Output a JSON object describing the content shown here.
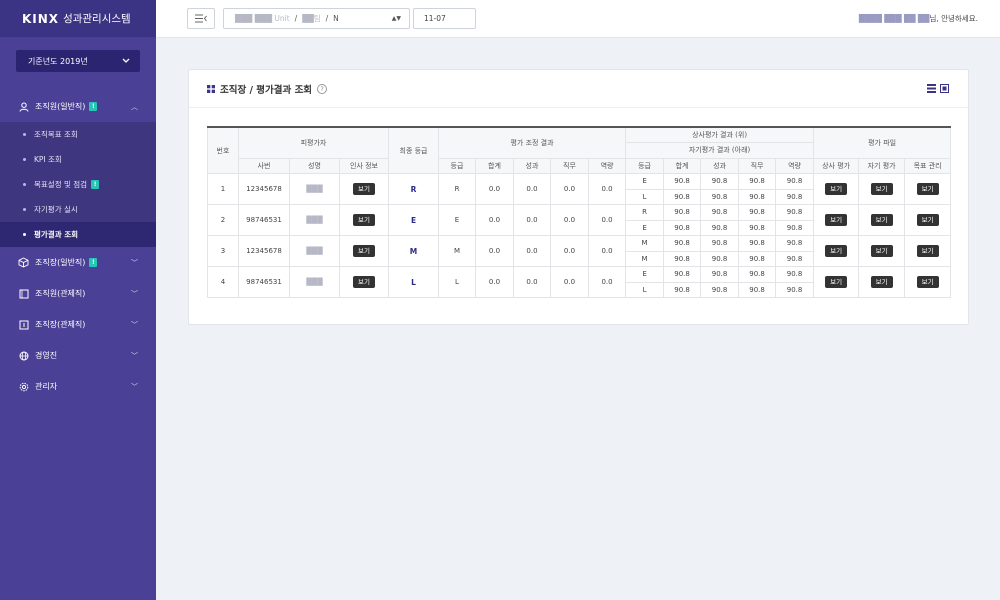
{
  "app": {
    "brand": "KINX",
    "system_name": "성과관리시스템"
  },
  "year_select": {
    "value": "기준년도 2019년"
  },
  "sidebar": {
    "items": [
      {
        "label": "조직원(일반직)",
        "badge": "!",
        "expanded": true,
        "sub": [
          {
            "label": "조직목표 조회"
          },
          {
            "label": "KPI 조회"
          },
          {
            "label": "목표설정 및 점검",
            "badge": "!"
          },
          {
            "label": "자기평가 실시"
          },
          {
            "label": "평가결과 조회",
            "active": true
          }
        ]
      },
      {
        "label": "조직장(일반직)",
        "badge": "!"
      },
      {
        "label": "조직원(관제직)"
      },
      {
        "label": "조직장(관제직)"
      },
      {
        "label": "경영진"
      },
      {
        "label": "관리자"
      }
    ]
  },
  "topbar": {
    "org_blur": "███ ███ Unit",
    "org_blur2": "██팀",
    "org_sep": "/",
    "org_last": "N",
    "date_value": "11-07",
    "greeting_blur": "████ ███ ██ ██",
    "greeting_suffix": "님, 안녕하세요."
  },
  "card": {
    "title": "조직장 / 평가결과 조회",
    "help": "?"
  },
  "table": {
    "headers": {
      "no": "번호",
      "evaluatee": "피평가자",
      "emp_no": "사번",
      "name": "성명",
      "hr_info": "인사 정보",
      "final_grade": "최종 등급",
      "adjust": "평가 조정 결과",
      "grade": "등급",
      "total": "합계",
      "perf": "성과",
      "duty": "직무",
      "comp": "역량",
      "upper": "상사평가 결과 (위)",
      "self": "자기평가 결과 (아래)",
      "files": "평가 파일",
      "boss_eval": "상사 평가",
      "self_eval": "자기 평가",
      "goal_mgmt": "목표 관리"
    },
    "view_label": "보기",
    "rows": [
      {
        "no": "1",
        "emp_no": "12345678",
        "name": "███",
        "final": "R",
        "adj": {
          "grade": "R",
          "total": "0.0",
          "perf": "0.0",
          "duty": "0.0",
          "comp": "0.0"
        },
        "upper": {
          "grade": "E",
          "total": "90.8",
          "perf": "90.8",
          "duty": "90.8",
          "comp": "90.8"
        },
        "self": {
          "grade": "L",
          "total": "90.8",
          "perf": "90.8",
          "duty": "90.8",
          "comp": "90.8"
        }
      },
      {
        "no": "2",
        "emp_no": "98746531",
        "name": "███",
        "final": "E",
        "adj": {
          "grade": "E",
          "total": "0.0",
          "perf": "0.0",
          "duty": "0.0",
          "comp": "0.0"
        },
        "upper": {
          "grade": "R",
          "total": "90.8",
          "perf": "90.8",
          "duty": "90.8",
          "comp": "90.8"
        },
        "self": {
          "grade": "E",
          "total": "90.8",
          "perf": "90.8",
          "duty": "90.8",
          "comp": "90.8"
        }
      },
      {
        "no": "3",
        "emp_no": "12345678",
        "name": "███",
        "final": "M",
        "adj": {
          "grade": "M",
          "total": "0.0",
          "perf": "0.0",
          "duty": "0.0",
          "comp": "0.0"
        },
        "upper": {
          "grade": "M",
          "total": "90.8",
          "perf": "90.8",
          "duty": "90.8",
          "comp": "90.8"
        },
        "self": {
          "grade": "M",
          "total": "90.8",
          "perf": "90.8",
          "duty": "90.8",
          "comp": "90.8"
        }
      },
      {
        "no": "4",
        "emp_no": "98746531",
        "name": "███",
        "final": "L",
        "adj": {
          "grade": "L",
          "total": "0.0",
          "perf": "0.0",
          "duty": "0.0",
          "comp": "0.0"
        },
        "upper": {
          "grade": "E",
          "total": "90.8",
          "perf": "90.8",
          "duty": "90.8",
          "comp": "90.8"
        },
        "self": {
          "grade": "L",
          "total": "90.8",
          "perf": "90.8",
          "duty": "90.8",
          "comp": "90.8"
        }
      }
    ]
  },
  "colors": {
    "sidebar_bg": "#4a4196",
    "sidebar_active": "#2e2772",
    "badge": "#28c4b4",
    "grade_text": "#2e2a8a"
  }
}
